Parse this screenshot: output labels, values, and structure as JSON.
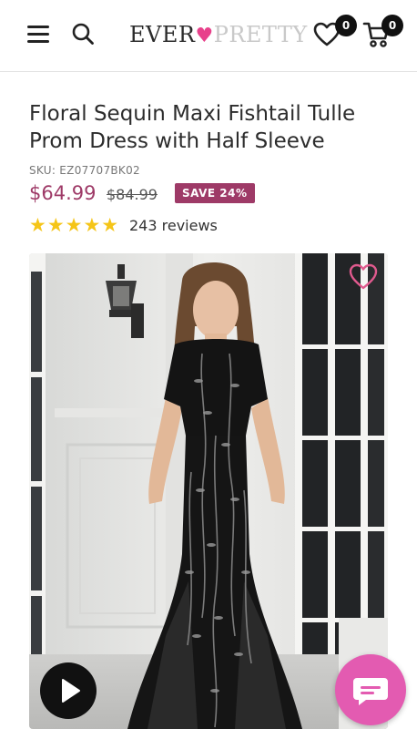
{
  "header": {
    "logo_part1": "EVER",
    "logo_heart": "♥",
    "logo_part2": "PRETTY",
    "wishlist_count": "0",
    "cart_count": "0",
    "icons": [
      "menu-icon",
      "search-icon",
      "heart-icon",
      "cart-icon"
    ]
  },
  "product": {
    "title": "Floral Sequin Maxi Fishtail Tulle Prom Dress with Half Sleeve",
    "sku": "SKU: EZ07707BK02",
    "price": "$64.99",
    "compare_price": "$84.99",
    "save_label": "SAVE 24%",
    "stars": "★★★★★",
    "rating": 5,
    "reviews": "243 reviews"
  },
  "colors": {
    "accent": "#9e3a67",
    "star": "#f5c518",
    "logo_heart": "#e8418b",
    "chat_button": "#e35bb1"
  }
}
